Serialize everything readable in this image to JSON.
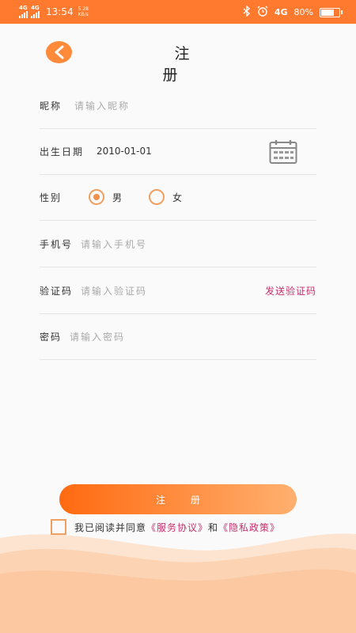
{
  "status_bar": {
    "network1": "4G",
    "network2": "4G",
    "time": "13:54",
    "speed": "5.28 KB/s",
    "lte": "4G",
    "battery": "80%",
    "battery_level": 0.8
  },
  "header": {
    "title": "注 册"
  },
  "form": {
    "nickname": {
      "label": "昵称",
      "placeholder": "请输入昵称"
    },
    "birthday": {
      "label": "出生日期",
      "value": "2010-01-01"
    },
    "gender": {
      "label": "性别",
      "options": [
        "男",
        "女"
      ],
      "selected": "男"
    },
    "phone": {
      "label": "手机号",
      "placeholder": "请输入手机号"
    },
    "code": {
      "label": "验证码",
      "placeholder": "请输入验证码",
      "send_label": "发送验证码"
    },
    "password": {
      "label": "密码",
      "placeholder": "请输入密码"
    }
  },
  "register_label": "注 册",
  "agreement": {
    "prefix": "我已阅读并同意",
    "service_link": "《服务协议》",
    "and": "和",
    "privacy_link": "《隐私政策》"
  },
  "colors": {
    "accent": "#ff7a2e",
    "link": "#c5316c",
    "radio": "#f0904a"
  }
}
